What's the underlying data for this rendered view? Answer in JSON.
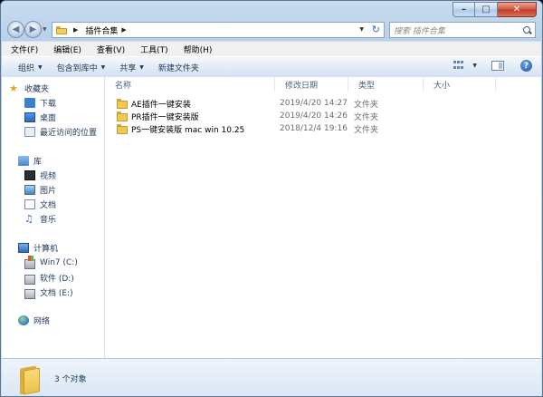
{
  "address": {
    "path": [
      "插件合集"
    ]
  },
  "search": {
    "placeholder": "搜索 插件合集"
  },
  "menu": [
    "文件(F)",
    "编辑(E)",
    "查看(V)",
    "工具(T)",
    "帮助(H)"
  ],
  "commands": {
    "organize": "组织",
    "include": "包含到库中",
    "share": "共享",
    "new_folder": "新建文件夹"
  },
  "nav": {
    "favorites": {
      "label": "收藏夹",
      "items": [
        "下载",
        "桌面",
        "最近访问的位置"
      ]
    },
    "libraries": {
      "label": "库",
      "items": [
        "视频",
        "图片",
        "文档",
        "音乐"
      ]
    },
    "computer": {
      "label": "计算机",
      "drives": [
        "Win7 (C:)",
        "软件 (D:)",
        "文档 (E:)"
      ]
    },
    "network": {
      "label": "网络"
    }
  },
  "columns": {
    "name": "名称",
    "modified": "修改日期",
    "type": "类型",
    "size": "大小"
  },
  "files": [
    {
      "name": "AE插件一键安装",
      "modified": "2019/4/20 14:27",
      "type": "文件夹"
    },
    {
      "name": "PR插件一键安装版",
      "modified": "2019/4/20 14:26",
      "type": "文件夹"
    },
    {
      "name": "PS一键安装版 mac win 10.25",
      "modified": "2018/12/4 19:16",
      "type": "文件夹"
    }
  ],
  "status": {
    "count": "3 个对象"
  }
}
